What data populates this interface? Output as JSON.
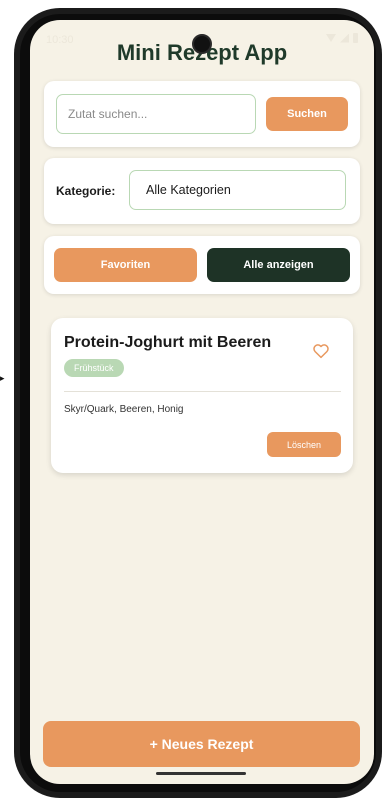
{
  "status_bar": {
    "time": "10:30"
  },
  "app": {
    "title": "Mini Rezept App"
  },
  "search": {
    "placeholder": "Zutat suchen...",
    "value": "",
    "button_label": "Suchen"
  },
  "category": {
    "label": "Kategorie:",
    "selected": "Alle Kategorien"
  },
  "filters": {
    "favorites_label": "Favoriten",
    "show_all_label": "Alle anzeigen"
  },
  "recipes": [
    {
      "title": "Protein-Joghurt mit Beeren",
      "category": "Frühstück",
      "ingredients": "Skyr/Quark, Beeren, Honig",
      "delete_label": "Löschen",
      "favorite_icon": "heart-outline-icon"
    }
  ],
  "footer": {
    "new_recipe_label": "+ Neues Rezept"
  },
  "colors": {
    "background": "#f6f2e6",
    "accent_orange": "#e8985e",
    "dark_green": "#1e3326",
    "light_green": "#b9d8b4",
    "title_green": "#1f3a2a"
  }
}
